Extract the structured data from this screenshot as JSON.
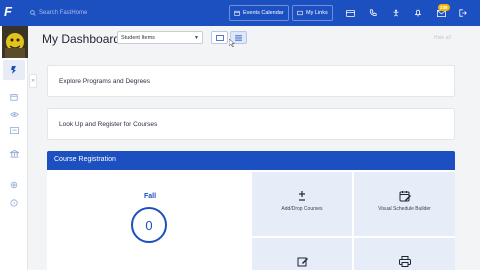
{
  "app": {
    "logo_text": "F"
  },
  "topbar": {
    "search_placeholder": "Search FastHome",
    "events_calendar_label": "Events Calendar",
    "my_links_label": "My Links",
    "notification_count": "238"
  },
  "header": {
    "title": "My Dashboard",
    "view_select_value": "Student Items",
    "hide_all_label": "Hide all"
  },
  "cards": {
    "explore_label": "Explore Programs and Degrees",
    "lookup_label": "Look Up and Register for Courses"
  },
  "registration": {
    "title": "Course Registration",
    "term_label": "Fall",
    "term_count": "0",
    "tiles": [
      {
        "label": "Add/Drop Courses",
        "icon": "plus-minus-icon"
      },
      {
        "label": "Visual Schedule Builder",
        "icon": "calendar-edit-icon"
      },
      {
        "label": "",
        "icon": "edit-icon"
      },
      {
        "label": "",
        "icon": "printer-icon"
      }
    ]
  },
  "colors": {
    "brand": "#1c4fc0",
    "tile_bg": "#e6edf8",
    "badge": "#f2b705"
  }
}
